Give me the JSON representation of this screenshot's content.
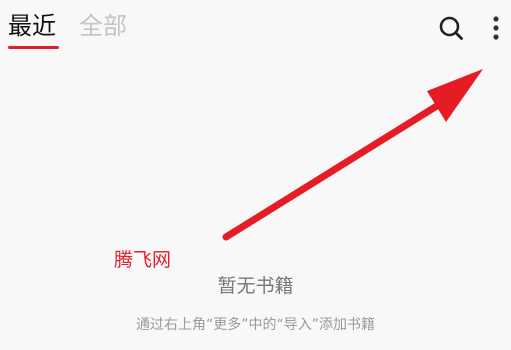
{
  "tabs": [
    {
      "label": "最近",
      "active": true
    },
    {
      "label": "全部",
      "active": false
    }
  ],
  "toolbar": {
    "search_icon": "search-icon",
    "more_icon": "more-vertical-icon"
  },
  "empty_state": {
    "title": "暂无书籍",
    "hint": "通过右上角“更多”中的“导入”添加书籍"
  },
  "watermark": "腾飞网",
  "colors": {
    "accent": "#e0202c",
    "background": "#f8f8f8",
    "arrow": "#e51c24"
  }
}
